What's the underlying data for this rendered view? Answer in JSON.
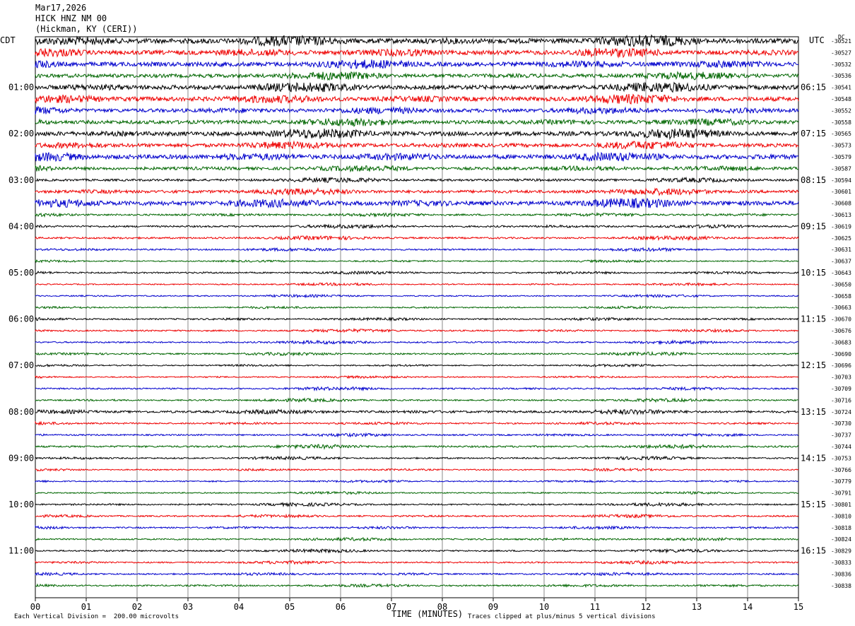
{
  "header": {
    "date": "Mar17,2026",
    "station": "HICK HNZ NM 00",
    "location": "(Hickman, KY (CERI))"
  },
  "left_tz": "CDT",
  "right_tz": "UTC",
  "dc_label": "DC",
  "footer": {
    "scale_note": "Each Vertical Division =  200.00 microvolts",
    "clip_note": "Traces clipped at plus/minus 5 vertical divisions",
    "x_title": "TIME (MINUTES)"
  },
  "colors": {
    "trace": [
      "#000000",
      "#ee0000",
      "#0000cc",
      "#006600"
    ],
    "grid": "#888888"
  },
  "chart_data": {
    "type": "line",
    "title": "HICK HNZ NM 00",
    "xlabel": "TIME (MINUTES)",
    "xlim": [
      0,
      15
    ],
    "x_ticks": [
      "00",
      "01",
      "02",
      "03",
      "04",
      "05",
      "06",
      "07",
      "08",
      "09",
      "10",
      "11",
      "12",
      "13",
      "14",
      "15"
    ],
    "left_hour_labels": [
      "01:00",
      "02:00",
      "03:00",
      "04:00",
      "05:00",
      "06:00",
      "07:00",
      "08:00",
      "09:00",
      "10:00",
      "11:00"
    ],
    "right_hour_labels": [
      "06:15",
      "07:15",
      "08:15",
      "09:15",
      "10:15",
      "11:15",
      "12:15",
      "13:15",
      "14:15",
      "15:15",
      "16:15"
    ],
    "trace_count": 48,
    "dc_offsets": [
      "-30521",
      "-30527",
      "-30532",
      "-30536",
      "-30541",
      "-30548",
      "-30552",
      "-30558",
      "-30565",
      "-30573",
      "-30579",
      "-30587",
      "-30594",
      "-30601",
      "-30608",
      "-30613",
      "-30619",
      "-30625",
      "-30631",
      "-30637",
      "-30643",
      "-30650",
      "-30658",
      "-30663",
      "-30670",
      "-30676",
      "-30683",
      "-30690",
      "-30696",
      "-30703",
      "-30709",
      "-30716",
      "-30724",
      "-30730",
      "-30737",
      "-30744",
      "-30753",
      "-30766",
      "-30779",
      "-30791",
      "-30801",
      "-30810",
      "-30818",
      "-30824",
      "-30829",
      "-30833",
      "-30836",
      "-30838"
    ],
    "trace_amplitude": [
      3.5,
      3,
      3,
      2.5,
      3,
      3,
      2.5,
      2.5,
      3,
      2.5,
      3,
      2,
      1.5,
      2,
      3,
      1.2,
      1.2,
      1.2,
      1,
      0.8,
      1,
      0.8,
      0.8,
      0.8,
      1,
      1,
      1,
      1,
      0.8,
      0.8,
      1,
      1,
      1.5,
      1,
      1,
      1.2,
      1,
      0.8,
      0.8,
      0.8,
      1,
      1,
      1,
      1,
      1,
      1,
      1,
      1
    ]
  }
}
